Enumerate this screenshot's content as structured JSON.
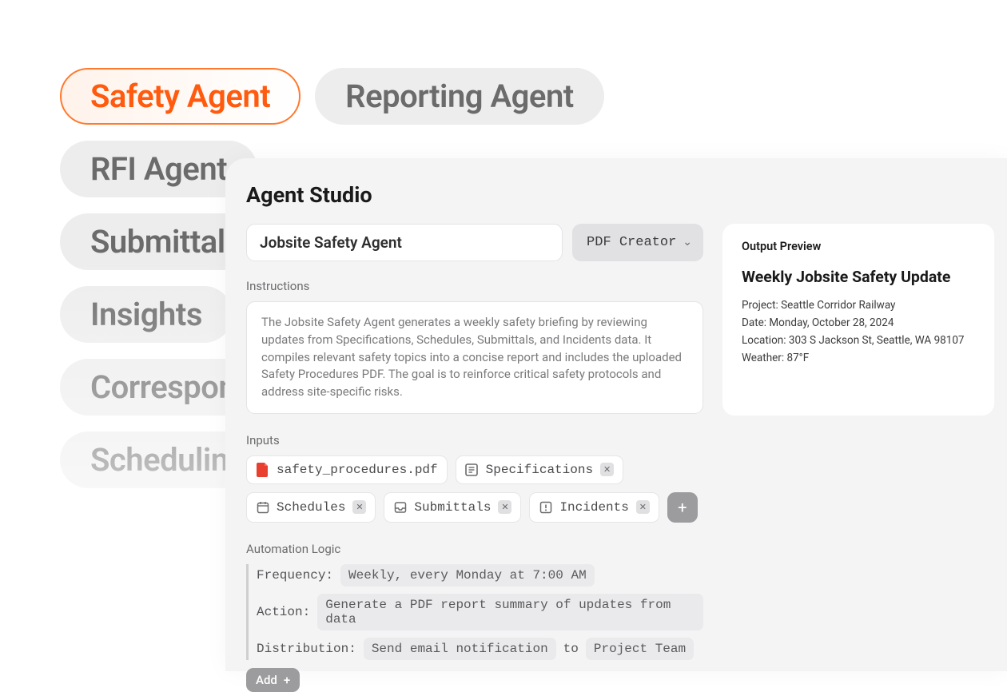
{
  "pills": {
    "row1": [
      "Safety Agent",
      "Reporting Agent"
    ],
    "row2": [
      "RFI Agent"
    ],
    "others": [
      "Submittals",
      "Insights",
      "Correspondence",
      "Scheduling"
    ]
  },
  "panel": {
    "title": "Agent Studio",
    "agent_name": "Jobsite Safety Agent",
    "output_type": "PDF Creator",
    "instructions_label": "Instructions",
    "instructions_text": "The Jobsite Safety Agent generates a weekly safety briefing by reviewing updates from Specifications, Schedules, Submittals, and Incidents data. It compiles relevant safety topics into a concise report and includes the uploaded Safety Procedures PDF. The goal is to reinforce critical safety protocols and address site-specific risks.",
    "inputs_label": "Inputs",
    "inputs": [
      {
        "icon": "pdf",
        "label": "safety_procedures.pdf",
        "closable": false
      },
      {
        "icon": "doc",
        "label": "Specifications",
        "closable": true
      },
      {
        "icon": "calendar",
        "label": "Schedules",
        "closable": true
      },
      {
        "icon": "inbox",
        "label": "Submittals",
        "closable": true
      },
      {
        "icon": "alert",
        "label": "Incidents",
        "closable": true
      }
    ],
    "automation_label": "Automation Logic",
    "automation": {
      "frequency_key": "Frequency:",
      "frequency_val": "Weekly, every Monday at 7:00 AM",
      "action_key": "Action:",
      "action_val": "Generate a PDF report summary of updates from data",
      "distribution_key": "Distribution:",
      "distribution_val": "Send email notification",
      "distribution_to": "to",
      "distribution_target": "Project Team"
    },
    "add_label": "Add"
  },
  "preview": {
    "label": "Output Preview",
    "title": "Weekly Jobsite Safety Update",
    "project": "Project: Seattle Corridor Railway",
    "date": "Date: Monday, October 28, 2024",
    "location": "Location: 303 S Jackson St, Seattle, WA 98107",
    "weather": "Weather: 87°F"
  }
}
